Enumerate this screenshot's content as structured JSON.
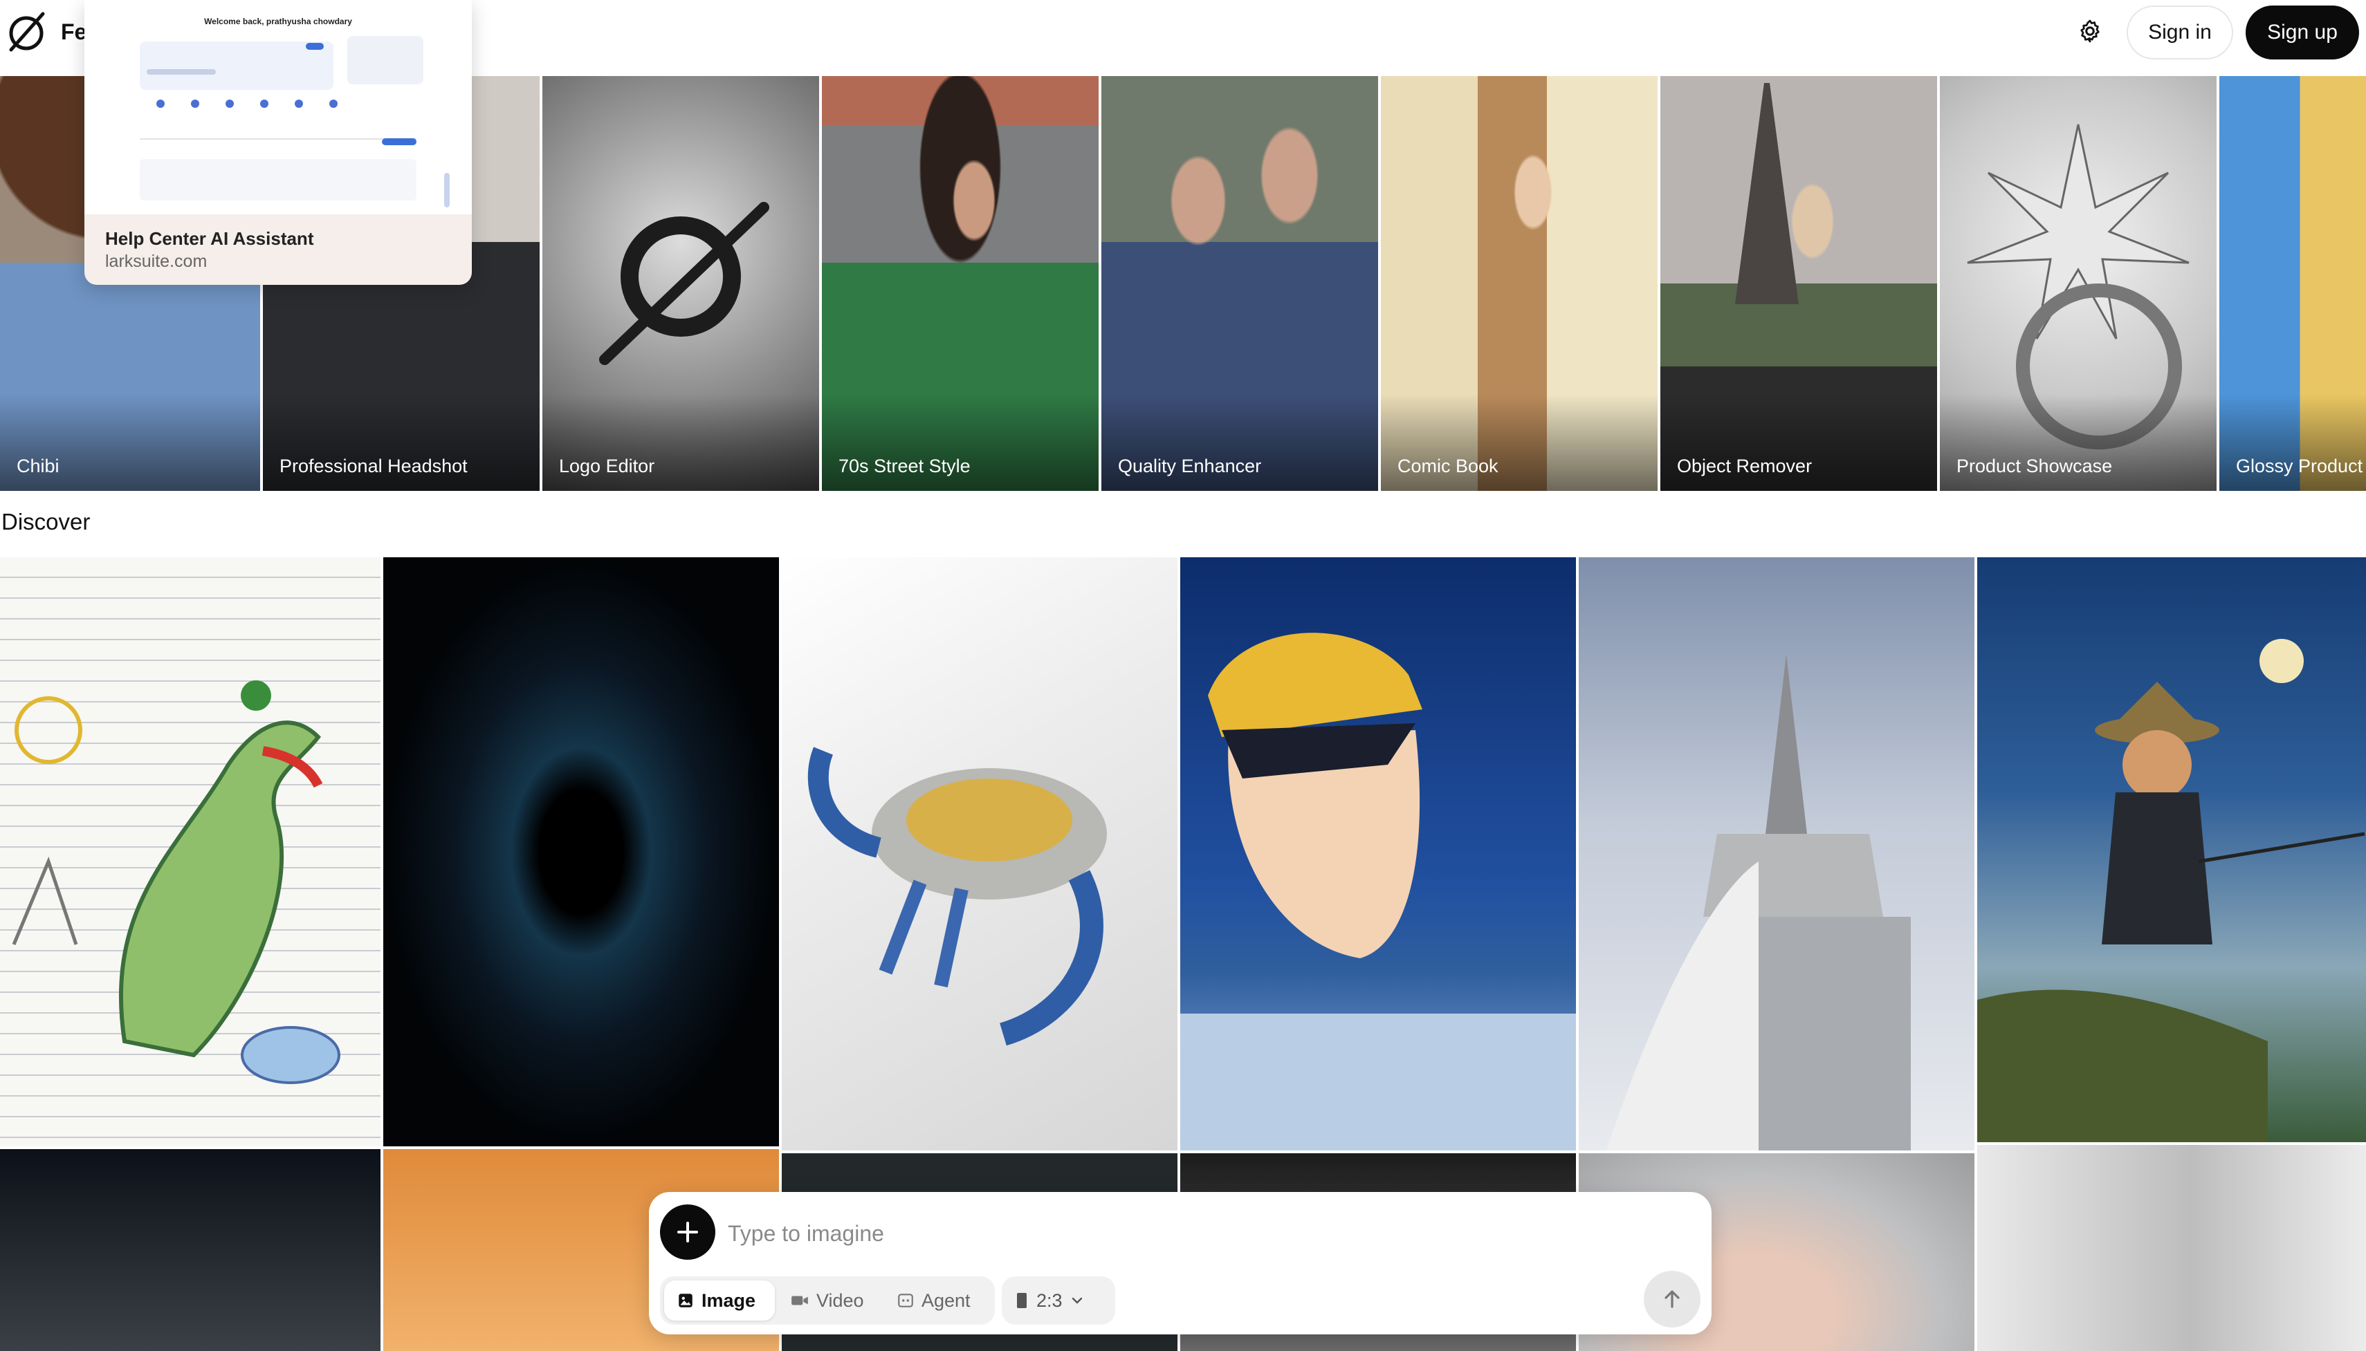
{
  "header": {
    "brand": "Fe",
    "logo_icon": "slashed-circle-logo-icon",
    "settings_icon": "gear-icon",
    "sign_in": "Sign in",
    "sign_up": "Sign up"
  },
  "popover": {
    "title": "Help Center AI Assistant",
    "url": "larksuite.com",
    "preview_heading": "Welcome back, prathyusha chowdary"
  },
  "tools": [
    {
      "label": "Chibi"
    },
    {
      "label": "Professional Headshot"
    },
    {
      "label": "Logo Editor"
    },
    {
      "label": "70s Street Style"
    },
    {
      "label": "Quality Enhancer"
    },
    {
      "label": "Comic Book"
    },
    {
      "label": "Object Remover"
    },
    {
      "label": "Product Showcase"
    },
    {
      "label": "Glossy Product"
    }
  ],
  "discover": {
    "title": "Discover"
  },
  "prompt": {
    "placeholder": "Type to imagine",
    "add_icon": "plus-icon",
    "modes": [
      {
        "label": "Image",
        "icon": "image-icon",
        "active": true
      },
      {
        "label": "Video",
        "icon": "video-camera-icon",
        "active": false
      },
      {
        "label": "Agent",
        "icon": "agent-icon",
        "active": false
      }
    ],
    "aspect_ratio": "2:3",
    "send_icon": "arrow-up-icon"
  },
  "colors": {
    "primary_button": "#0b0b0b",
    "background": "#ffffff"
  }
}
